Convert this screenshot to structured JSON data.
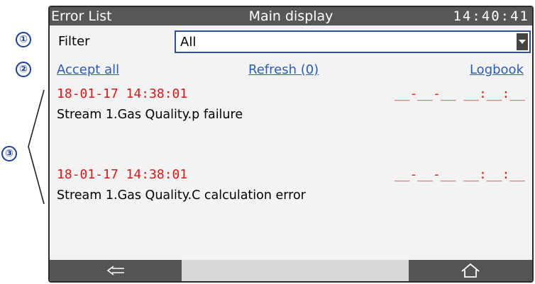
{
  "callouts": [
    "①",
    "②",
    "③"
  ],
  "window": {
    "title_left": "Error List",
    "title_center": "Main display",
    "clock": "14:40:41"
  },
  "filter": {
    "label": "Filter",
    "selected": "All",
    "arrow_icon": "chevron-down-icon"
  },
  "actions": {
    "accept_all": "Accept all",
    "refresh": "Refresh (0)",
    "logbook": "Logbook"
  },
  "entries": [
    {
      "timestamp": "18-01-17 14:38:01",
      "ack": "__-__-__ __:__:__",
      "message": "Stream 1.Gas Quality.p failure"
    },
    {
      "timestamp": "18-01-17 14:38:01",
      "ack": "__-__-__ __:__:__",
      "message": "Stream 1.Gas Quality.C calculation error"
    }
  ],
  "navbar": {
    "back_icon": "arrow-left-icon",
    "home_icon": "home-icon"
  },
  "colors": {
    "accent": "#2b5bb8",
    "alarm": "#e41414",
    "titlebar": "#575757"
  }
}
